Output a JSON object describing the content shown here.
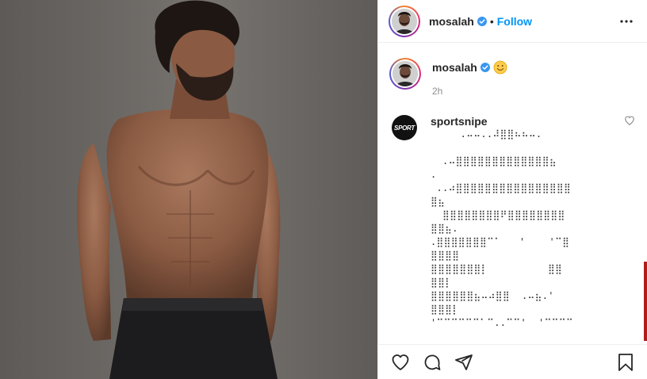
{
  "post": {
    "author": {
      "username": "mosalah",
      "separator": "•",
      "follow_label": "Follow"
    },
    "caption": {
      "username": "mosalah",
      "emoji": "slightly-smiling-face",
      "time": "2h"
    },
    "comments": [
      {
        "username": "sportsnipe",
        "avatar_text": "SPORT",
        "lines": [
          "     .⠤⠤..⠼⣿⣿⠦⠦⠤.",
          "",
          "  .⠤⣿⣿⣿⣿⣿⣿⣿⣿⣿⣿⣿⣿⣿⣦",
          ".",
          " ..⠴⣿⣿⣿⣿⣿⣿⣿⣿⣿⣿⣿⣿⣿⣿⣿⣿",
          "⣿⣦",
          "  ⣿⣿⣿⣿⣿⣿⣿⣿⠟⣿⣿⣿⣿⣿⣿⣿⣿",
          "⣿⣿⣦.",
          ".⣿⣿⣿⣿⣿⣿⣿⠉⠁   '    '⠉⣿",
          "⣿⣿⣿⣿",
          "⣿⣿⣿⣿⣿⣿⣿⡇          ⣿⣿",
          "⣿⣿⡇",
          "⣿⣿⣿⣿⣿⣿⣦⠤⠴⣿⣿  .⠤⣦.'",
          "⣿⣿⣿⡇",
          "'⠉⠉⠉⠉⠉⠉⠁⠉..⠉⠉'  '⠉⠉⠉⠉"
        ]
      }
    ]
  },
  "icons": {
    "more": "more-options-icon",
    "like": "heart-icon",
    "comment": "comment-icon",
    "share": "share-icon",
    "save": "bookmark-icon",
    "verified": "verified-badge-icon"
  },
  "colors": {
    "accent": "#0095f6",
    "border": "#efefef",
    "muted": "#8e8e8e"
  }
}
